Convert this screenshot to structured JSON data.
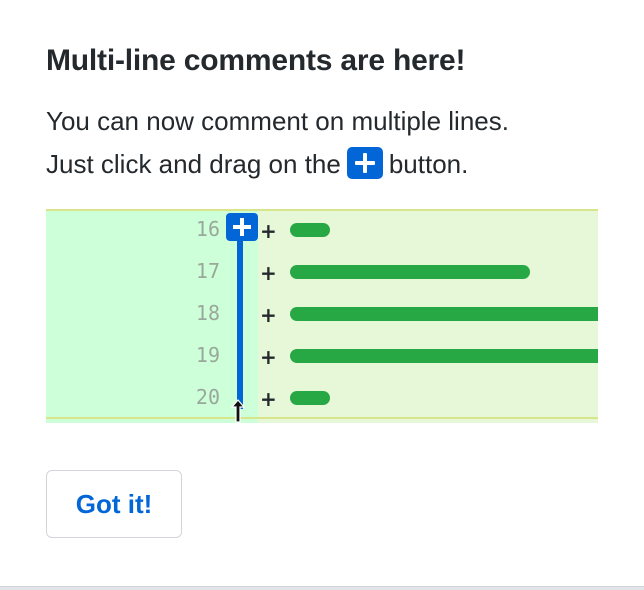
{
  "tip": {
    "title": "Multi-line comments are here!",
    "line1": "You can now comment on multiple lines.",
    "line2_before": "Just click and drag on the",
    "line2_after": "button."
  },
  "diff": {
    "line_numbers": [
      "16",
      "17",
      "18",
      "19",
      "20"
    ],
    "added_marker": "+",
    "add_color": "#28a745",
    "accent_color": "#0366d6"
  },
  "actions": {
    "got_it_label": "Got it!"
  }
}
